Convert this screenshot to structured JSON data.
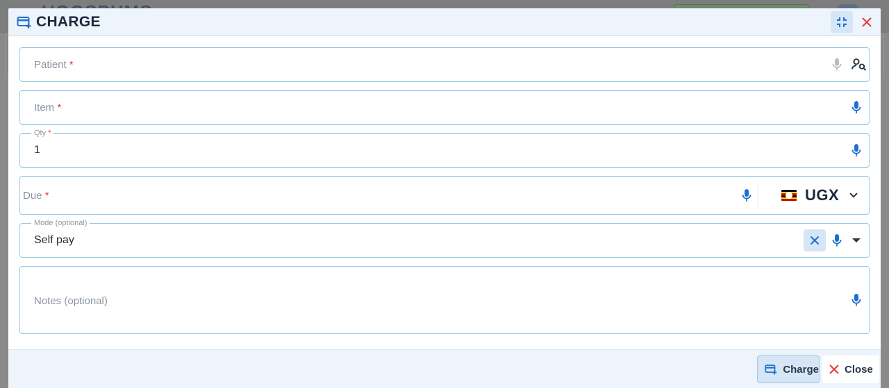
{
  "background": {
    "brand_text": "UGOSPHMS"
  },
  "dialog": {
    "title": "CHARGE",
    "title_icon": "card-plus-icon",
    "minimize_icon": "collapse-icon",
    "close_icon": "close-icon"
  },
  "form": {
    "patient": {
      "label": "Patient",
      "required_mark": "*",
      "value": ""
    },
    "item": {
      "label": "Item",
      "required_mark": "*",
      "value": ""
    },
    "qty": {
      "label": "Qty",
      "required_mark": "*",
      "value": "1"
    },
    "due": {
      "label": "Due",
      "required_mark": "*",
      "value": "",
      "currency": "UGX"
    },
    "mode": {
      "label": "Mode (optional)",
      "value": "Self pay"
    },
    "notes": {
      "label": "Notes (optional)",
      "value": ""
    }
  },
  "footer": {
    "charge_label": "Charge",
    "close_label": "Close"
  },
  "colors": {
    "accent": "#1565c0",
    "mic": "#1e6fd0",
    "required": "#e53935",
    "close_red": "#e53935",
    "field_border": "#9ccbe6",
    "header_bg": "#eef4fb"
  }
}
